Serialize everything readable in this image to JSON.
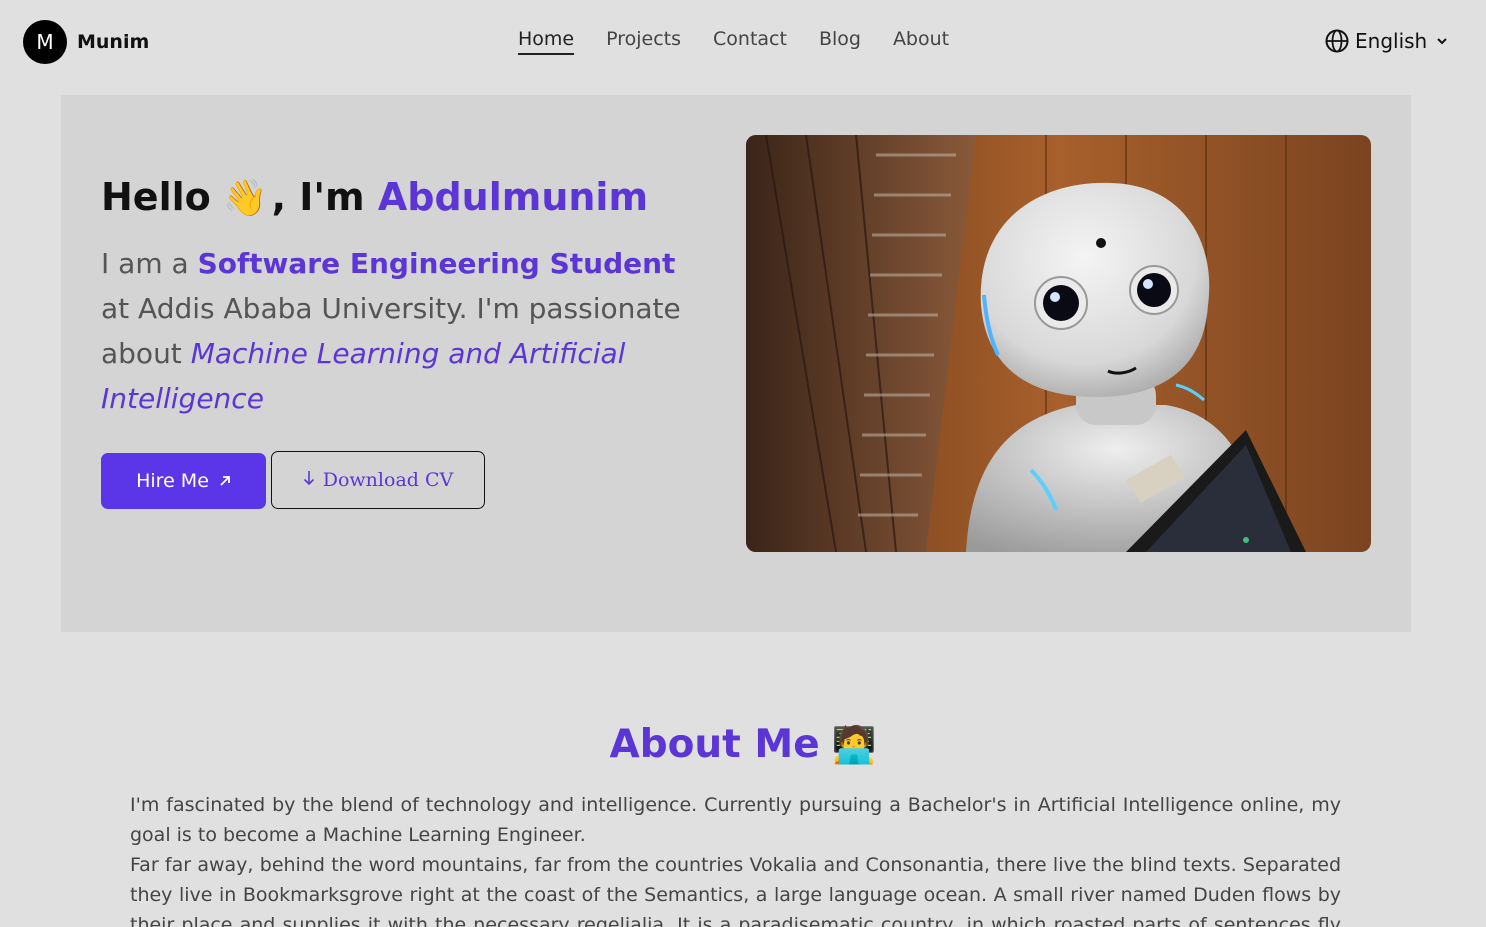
{
  "nav": {
    "logo_letter": "M",
    "logo_name": "Munim",
    "links": [
      "Home",
      "Projects",
      "Contact",
      "Blog",
      "About"
    ],
    "active": "Home",
    "language": "English"
  },
  "hero": {
    "greeting": "Hello",
    "wave_emoji": "👋",
    "intro": ", I'm",
    "name": "Abdulmunim",
    "text_1": "I am a ",
    "role": "Software Engineering Student",
    "text_2": " at Addis Ababa University. I'm passionate about ",
    "interest": "Machine Learning and Artificial Intelligence",
    "hire_label": "Hire Me",
    "hire_icon": "arrow-up-right-icon",
    "cv_label": "Download CV",
    "cv_icon": "arrow-down-icon",
    "image_subject": "white humanoid robot photo"
  },
  "about": {
    "title": "About Me",
    "emoji": "🧑‍💻",
    "paragraph_1": "I'm fascinated by the blend of technology and intelligence. Currently pursuing a Bachelor's in Artificial Intelligence online, my goal is to become a Machine Learning Engineer.",
    "paragraph_2": "Far far away, behind the word mountains, far from the countries Vokalia and Consonantia, there live the blind texts. Separated they live in Bookmarksgrove right at the coast of the Semantics, a large language ocean. A small river named Duden flows by their place and supplies it with the necessary regelialia. It is a paradisematic country, in which roasted parts of sentences fly into your"
  },
  "colors": {
    "accent": "#5b35d5",
    "button": "#5b35e8",
    "page_bg": "#e0e0e0",
    "hero_bg": "#d4d4d4"
  }
}
